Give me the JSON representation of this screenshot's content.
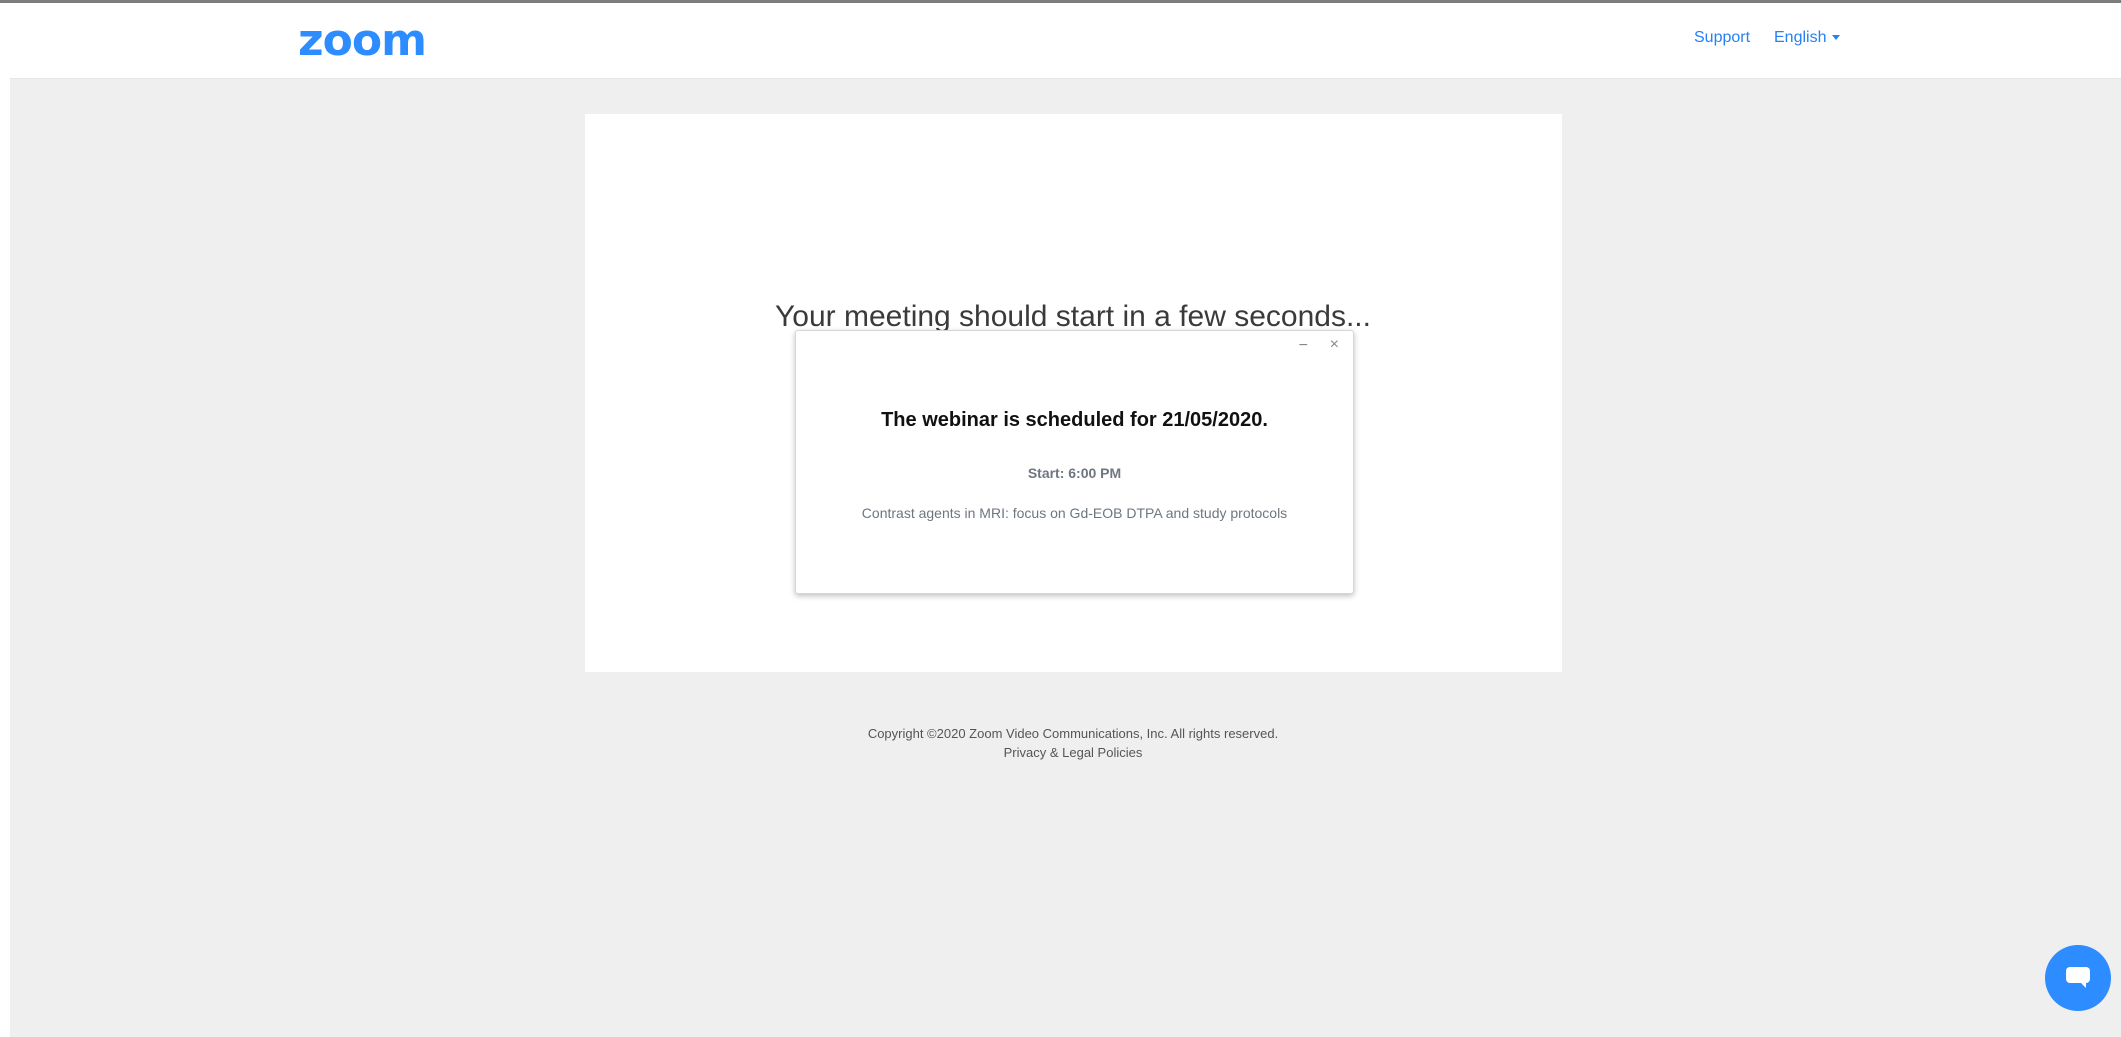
{
  "header": {
    "logo_text": "zoom",
    "support_label": "Support",
    "language_label": "English"
  },
  "main": {
    "headline": "Your meeting should start in a few seconds..."
  },
  "dialog": {
    "minimize_symbol": "−",
    "close_symbol": "×",
    "title": "The webinar is scheduled for 21/05/2020.",
    "start_text": "Start: 6:00 PM",
    "description": "Contrast agents in MRI: focus on Gd-EOB DTPA and study protocols"
  },
  "footer": {
    "copyright": "Copyright ©2020 Zoom Video Communications, Inc. All rights reserved.",
    "privacy_link": "Privacy & Legal Policies"
  },
  "colors": {
    "brand_blue": "#2d8cff",
    "link_blue": "#2681f2",
    "page_background": "#efefef"
  },
  "icons": {
    "chat": "chat-bubble-icon",
    "language_dropdown": "caret-down-icon"
  }
}
